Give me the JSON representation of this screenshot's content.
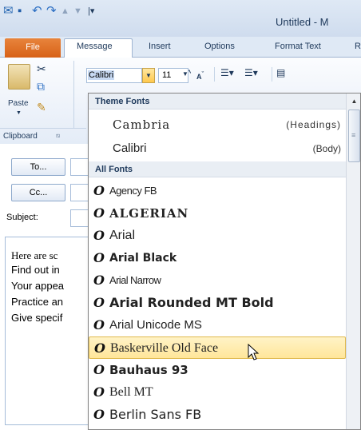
{
  "title_bar": {
    "title": "Untitled - M",
    "qat_icons": [
      "outlook-icon",
      "save-icon",
      "undo-icon",
      "redo-icon",
      "up-arrow-icon",
      "down-arrow-icon",
      "customize-qat-icon"
    ]
  },
  "tabs": [
    "File",
    "Message",
    "Insert",
    "Options",
    "Format Text",
    "R"
  ],
  "ribbon": {
    "paste_label": "Paste",
    "clipboard_label": "Clipboard",
    "font_name": "Calibri",
    "font_size": "11"
  },
  "compose": {
    "to_label": "To...",
    "cc_label": "Cc...",
    "subject_label": "Subject:",
    "body_lines": [
      "Here are sc",
      "Find out in",
      "Your appea",
      "Practice an",
      "Give specif"
    ]
  },
  "font_dropdown": {
    "theme_header": "Theme Fonts",
    "theme_fonts": [
      {
        "name": "Cambria",
        "role": "(Headings)"
      },
      {
        "name": "Calibri",
        "role": "(Body)"
      }
    ],
    "all_header": "All Fonts",
    "fonts": [
      "Agency FB",
      "ALGERIAN",
      "Arial",
      "Arial Black",
      "Arial Narrow",
      "Arial Rounded MT Bold",
      "Arial Unicode MS",
      "Baskerville Old Face",
      "Bauhaus 93",
      "Bell MT",
      "Berlin Sans FB"
    ],
    "highlighted": "Baskerville Old Face"
  },
  "colors": {
    "file_tab": "#d76117",
    "highlight": "#ffe69a",
    "ribbon_text": "#1e395b"
  }
}
